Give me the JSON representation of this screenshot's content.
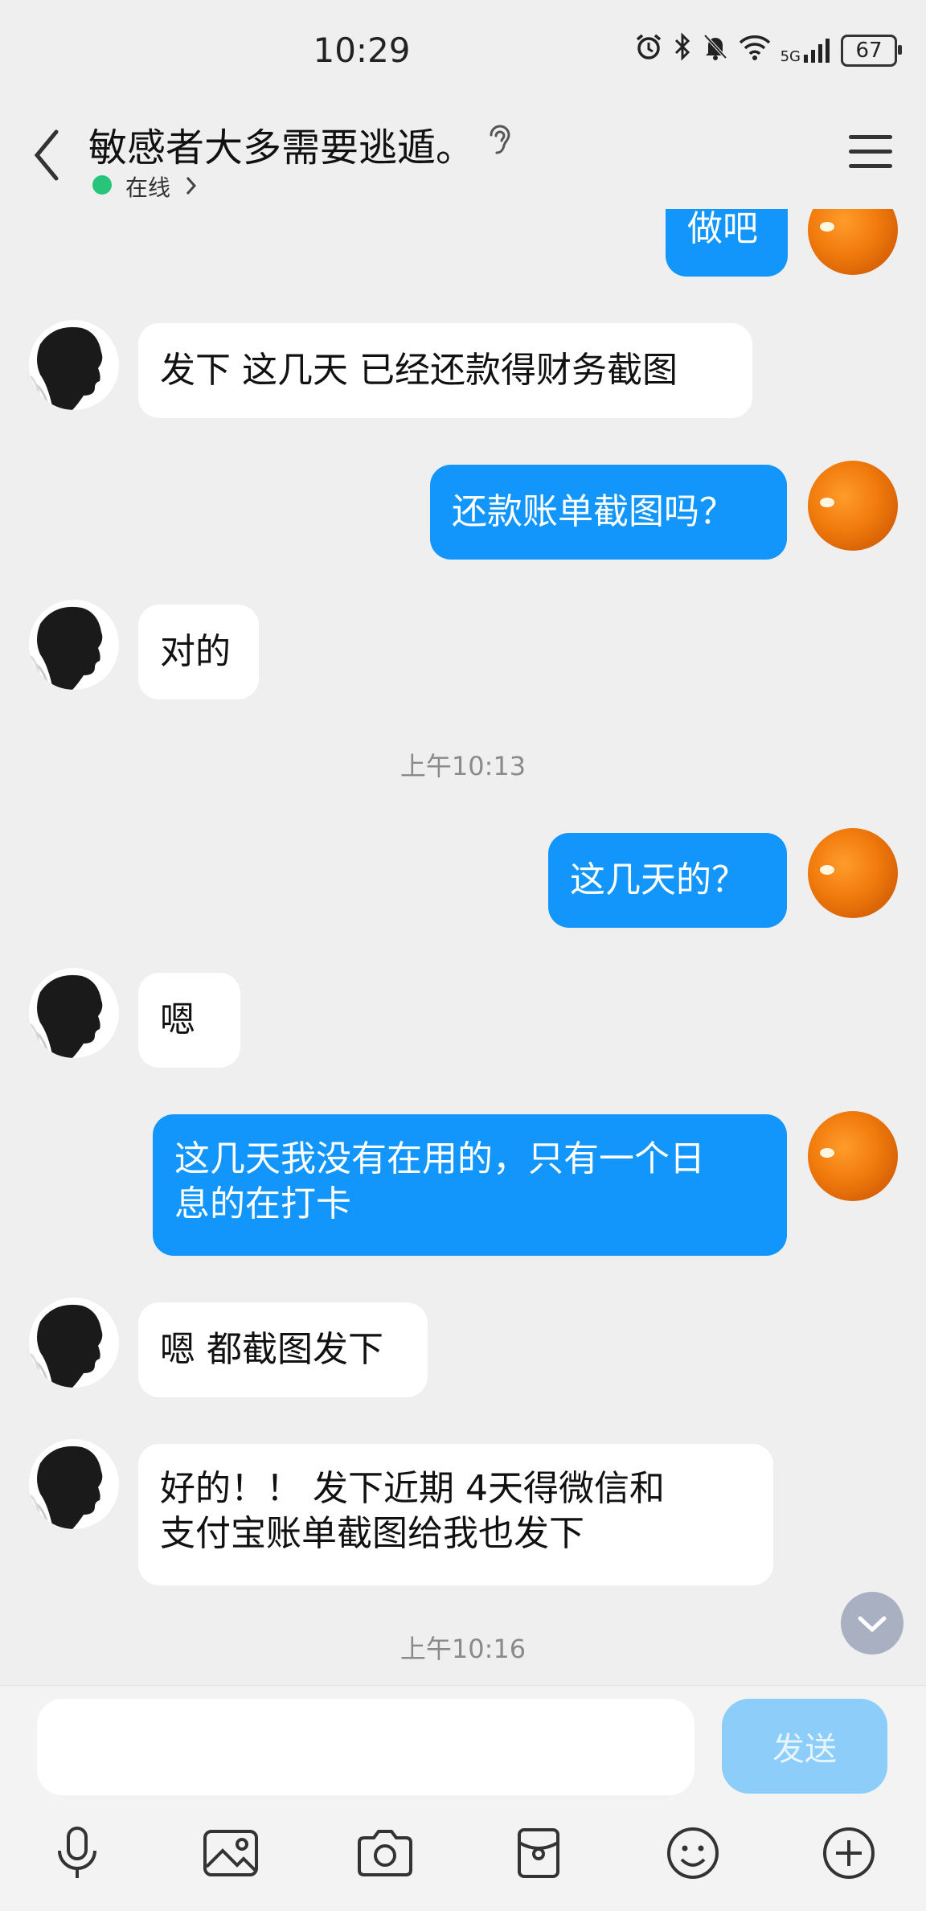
{
  "status_bar": {
    "time": "10:29",
    "network": "5G",
    "battery": "67"
  },
  "header": {
    "title": "敏感者大多需要逃遁。",
    "status": "在线"
  },
  "messages": [
    {
      "side": "out",
      "text": "做吧"
    },
    {
      "side": "in",
      "text": "发下 这几天 已经还款得财务截图"
    },
    {
      "side": "out",
      "text": "还款账单截图吗？"
    },
    {
      "side": "in",
      "text": "对的"
    },
    {
      "side": "time",
      "text": "上午10:13"
    },
    {
      "side": "out",
      "text": "这几天的？"
    },
    {
      "side": "in",
      "text": "嗯"
    },
    {
      "side": "out",
      "lines": [
        "这几天我没有在用的，只有一个日",
        "息的在打卡"
      ]
    },
    {
      "side": "in",
      "text": "嗯 都截图发下"
    },
    {
      "side": "in",
      "lines": [
        "好的！！ 发下近期 4天得微信和",
        "支付宝账单截图给我也发下"
      ]
    },
    {
      "side": "time",
      "text": "上午10:16"
    }
  ],
  "input": {
    "placeholder": ""
  },
  "send_label": "发送",
  "toolbar": [
    "microphone-icon",
    "image-icon",
    "camera-icon",
    "red-packet-icon",
    "emoji-icon",
    "plus-icon"
  ],
  "colors": {
    "outgoing": "#1296fb",
    "incoming": "#ffffff",
    "background": "#efefef",
    "send_disabled": "#8ccdf9"
  }
}
